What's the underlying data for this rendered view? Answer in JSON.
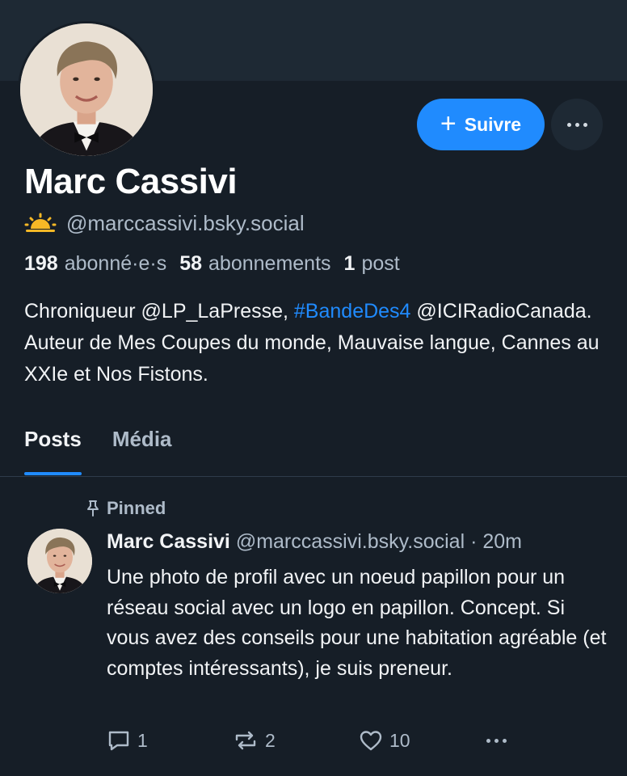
{
  "profile": {
    "name": "Marc Cassivi",
    "handle": "@marccassivi.bsky.social",
    "follow_label": "Suivre",
    "stats": {
      "followers_count": "198",
      "followers_label": "abonné·e·s",
      "following_count": "58",
      "following_label": "abonnements",
      "posts_count": "1",
      "posts_label": "post"
    },
    "bio": {
      "part1": "Chroniqueur @LP_LaPresse, ",
      "hashtag": "#BandeDes4",
      "part2": " @ICIRadioCanada. Auteur de Mes Coupes du monde, Mauvaise langue, Cannes au XXIe et Nos Fistons."
    }
  },
  "tabs": [
    {
      "label": "Posts",
      "active": true
    },
    {
      "label": "Média",
      "active": false
    }
  ],
  "post": {
    "pinned_label": "Pinned",
    "author": "Marc Cassivi",
    "handle": "@marccassivi.bsky.social",
    "separator": " · ",
    "time": "20m",
    "text": "Une photo de profil avec un noeud papillon pour un réseau social avec un logo en papillon. Concept. Si vous avez des conseils pour une habitation agréable (et comptes intéressants), je suis preneur.",
    "replies": "1",
    "reposts": "2",
    "likes": "10"
  },
  "colors": {
    "background": "#161e27",
    "banner": "#1e2934",
    "accent": "#208bfe",
    "muted_text": "#aebbc9"
  },
  "icons": [
    "sun-icon",
    "plus-icon",
    "more-icon",
    "pin-icon",
    "reply-icon",
    "repost-icon",
    "like-icon"
  ]
}
